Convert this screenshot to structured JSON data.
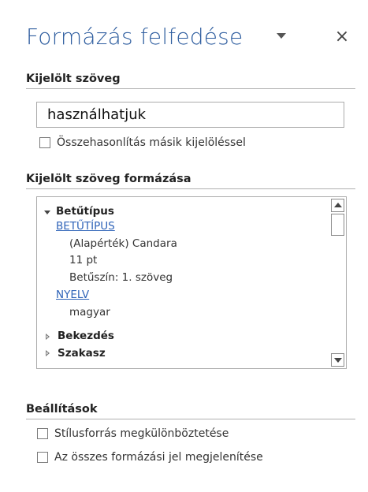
{
  "header": {
    "title": "Formázás felfedése",
    "close_glyph": "×"
  },
  "selected_text": {
    "heading": "Kijelölt szöveg",
    "value": "használhatjuk",
    "compare_label": "Összehasonlítás másik kijelöléssel",
    "compare_checked": false
  },
  "formatting": {
    "heading": "Kijelölt szöveg formázása",
    "font_group_label": "Betűtípus",
    "font_link": "BETŰTÍPUS",
    "font_name": "(Alapérték) Candara",
    "font_size": "11 pt",
    "font_color": "Betűszín: 1. szöveg",
    "language_link": "NYELV",
    "language_value": "magyar",
    "paragraph_label": "Bekezdés",
    "section_label": "Szakasz"
  },
  "options": {
    "heading": "Beállítások",
    "distinguish_style_label": "Stílusforrás megkülönböztetése",
    "distinguish_style_checked": false,
    "show_marks_label": "Az összes formázási jel megjelenítése",
    "show_marks_checked": false
  },
  "icons": {
    "dropdown": "chevron-down-icon",
    "close": "close-icon",
    "expanded": "expanded-triangle-icon",
    "collapsed": "collapsed-triangle-icon",
    "scroll_up": "scroll-up-arrow-icon",
    "scroll_down": "scroll-down-arrow-icon"
  },
  "colors": {
    "title": "#2e5d9f",
    "link": "#2e63b8"
  }
}
